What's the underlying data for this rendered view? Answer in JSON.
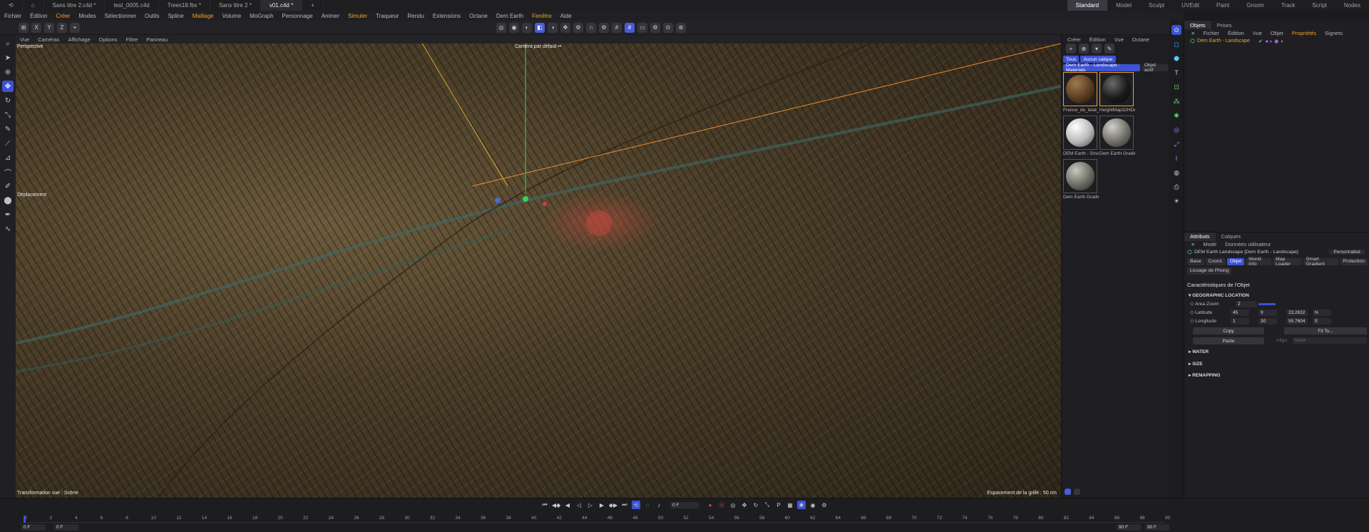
{
  "tabs": [
    "Sans titre 2.c4d *",
    "test_0005.c4d",
    "Trees18.fbx *",
    "Sans titre 2 *",
    "v01.c4d *"
  ],
  "layouts": [
    "Standard",
    "Model",
    "Sculpt",
    "UVEdit",
    "Paint",
    "Groom",
    "Track",
    "Script",
    "Nodes"
  ],
  "menu": [
    "Fichier",
    "Édition",
    "Créer",
    "Modes",
    "Sélectionner",
    "Outils",
    "Spline",
    "Maillage",
    "Volume",
    "MoGraph",
    "Personnage",
    "Animer",
    "Simuler",
    "Traqueur",
    "Rendu",
    "Extensions",
    "Octane",
    "Dem Earth",
    "Fenêtre",
    "Aide"
  ],
  "axes": {
    "x": "X",
    "y": "Y",
    "z": "Z"
  },
  "viewport": {
    "menu": [
      "Vue",
      "Caméras",
      "Affichage",
      "Options",
      "Filtre",
      "Panneau"
    ],
    "view_name": "Perspective",
    "camera": "Caméra par défaut ••",
    "tool": "Déplacement",
    "transform": "Transformation vue : Scène",
    "grid": "Espacement de la grille : 50 cm"
  },
  "materials": {
    "menu": [
      "Créer",
      "Édition",
      "Vue",
      "Octane"
    ],
    "filters": [
      "Tous",
      "Aucun calque",
      "Dem Earth - Landscape : Materials",
      "Objet actif"
    ],
    "items": [
      {
        "label": "France_de_letat_m",
        "color": "#6b4a2a"
      },
      {
        "label": "HeightMap32HDe",
        "color": "#2a2a2a"
      },
      {
        "label": "DEM Earth - Smar",
        "color": "#d8d8d8"
      },
      {
        "label": "Dem Earth Gradie",
        "color": "#9a9a96"
      },
      {
        "label": "Dem Earth Gradie",
        "color": "#8a8a86"
      }
    ]
  },
  "objects": {
    "tabs": [
      "Objets",
      "Prises"
    ],
    "menu": [
      "Fichier",
      "Édition",
      "Vue",
      "Objet",
      "Propriétés",
      "Signets"
    ],
    "item": "Dem Earth - Landscape"
  },
  "attributes": {
    "tabs": [
      "Attributs",
      "Calques"
    ],
    "mode": "Mode",
    "user_data": "Données utilisateur",
    "object_title": "DEM Earth Landscape [Dem Earth - Landscape]",
    "preset": "Personnalisé",
    "chips": [
      "Base",
      "Coord.",
      "Objet",
      "World Info",
      "Map Loader",
      "Smart Gradient",
      "Protection"
    ],
    "phong": "Lissage de Phong",
    "section_title": "Caractéristiques de l'Objet",
    "geo_header": "GEOGRAPHIC LOCATION",
    "area_zoom_label": "Area Zoom",
    "area_zoom": "2",
    "latitude_label": "Latitude",
    "lat_deg": "45",
    "lat_min": "9",
    "lat_sec": "23.2632",
    "lat_dir": "N",
    "longitude_label": "Longitude",
    "lon_deg": "1",
    "lon_min": "30",
    "lon_sec": "55.7604",
    "lon_dir": "E",
    "copy": "Copy",
    "fit": "Fit To...",
    "paste": "Paste",
    "align": "Align",
    "align_val": "None",
    "water": "WATER",
    "size": "SIZE",
    "remapping": "REMAPPING"
  },
  "timeline": {
    "ticks": [
      "0",
      "2",
      "4",
      "6",
      "8",
      "10",
      "12",
      "14",
      "16",
      "18",
      "20",
      "22",
      "24",
      "26",
      "28",
      "30",
      "32",
      "34",
      "36",
      "38",
      "40",
      "42",
      "44",
      "46",
      "48",
      "50",
      "52",
      "54",
      "56",
      "58",
      "60",
      "62",
      "64",
      "66",
      "68",
      "70",
      "72",
      "74",
      "76",
      "78",
      "80",
      "82",
      "84",
      "86",
      "88",
      "90"
    ],
    "current_frame": "0 F",
    "start": "0 F",
    "start2": "0 F",
    "end": "90 F",
    "end2": "90 F"
  }
}
